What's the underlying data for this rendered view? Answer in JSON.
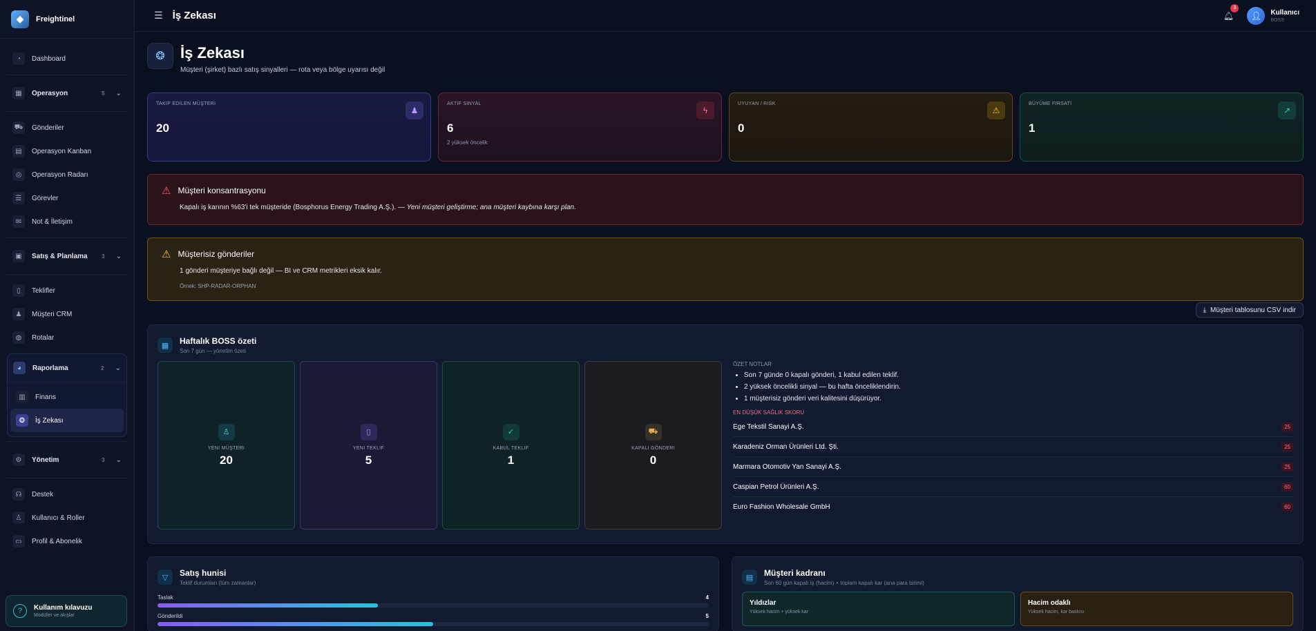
{
  "sidebar": {
    "brand": "Freightinel",
    "items": {
      "dashboard": "Dashboard",
      "operasyon": {
        "label": "Operasyon",
        "count": "5"
      },
      "gonderiler": "Gönderiler",
      "kanban": "Operasyon Kanban",
      "radar": "Operasyon Radarı",
      "gorevler": "Görevler",
      "not": "Not & İletişim",
      "satis": {
        "label": "Satış & Planlama",
        "count": "3"
      },
      "teklifler": "Teklifler",
      "crm": "Müşteri CRM",
      "rotalar": "Rotalar",
      "raporlama": {
        "label": "Raporlama",
        "count": "2"
      },
      "finans": "Finans",
      "iszekasi": "İş Zekası",
      "yonetim": {
        "label": "Yönetim",
        "count": "3"
      },
      "destek": "Destek",
      "kullanici": "Kullanıcı & Roller",
      "profil": "Profil & Abonelik"
    },
    "guide": {
      "title": "Kullanım kılavuzu",
      "sub": "Modüller ve akışlar"
    }
  },
  "topbar": {
    "title": "İş Zekası",
    "notif_count": "3",
    "user_name": "Kullanıcı",
    "user_role": "BOSS"
  },
  "page": {
    "title": "İş Zekası",
    "subtitle": "Müşteri (şirket) bazlı satış sinyalleri — rota veya bölge uyarısı değil"
  },
  "kpis": [
    {
      "label": "TAKIP EDILEN MÜŞTERI",
      "value": "20",
      "sub": ""
    },
    {
      "label": "AKTIF SINYAL",
      "value": "6",
      "sub": "2 yüksek öncelik"
    },
    {
      "label": "UYUYAN / RISK",
      "value": "0",
      "sub": ""
    },
    {
      "label": "BÜYÜME FIRSATI",
      "value": "1",
      "sub": ""
    }
  ],
  "alerts": {
    "concentration": {
      "title": "Müşteri konsantrasyonu",
      "body": "Kapalı iş karının %63'i tek müşteride (Bosphorus Energy Trading A.Ş.). — ",
      "emph": "Yeni müşteri geliştirme; ana müşteri kaybına karşı plan."
    },
    "orphan": {
      "title": "Müşterisiz gönderiler",
      "body": "1 gönderi müşteriye bağlı değil — BI ve CRM metrikleri eksik kalır.",
      "example": "Örnek: SHP-RADAR-ORPHAN"
    }
  },
  "csv_button": "Müşteri tablosunu CSV indir",
  "boss": {
    "title": "Haftalık BOSS özeti",
    "subtitle": "Son 7 gün — yönetim özeti",
    "cards": [
      {
        "label": "YENI MÜŞTERI",
        "value": "20"
      },
      {
        "label": "YENI TEKLIF",
        "value": "5"
      },
      {
        "label": "KABUL TEKLIF",
        "value": "1"
      },
      {
        "label": "KAPALI GÖNDERI",
        "value": "0"
      }
    ],
    "notes_heading": "ÖZET NOTLAR",
    "notes": [
      "Son 7 günde 0 kapalı gönderi, 1 kabul edilen teklif.",
      "2 yüksek öncelikli sinyal — bu hafta önceliklendirin.",
      "1 müşterisiz gönderi veri kalitesini düşürüyor."
    ],
    "low_heading": "EN DÜŞÜK SAĞLIK SKORU",
    "low": [
      {
        "name": "Ege Tekstil Sanayi A.Ş.",
        "score": "25"
      },
      {
        "name": "Karadeniz Orman Ürünleri Ltd. Şti.",
        "score": "25"
      },
      {
        "name": "Marmara Otomotiv Yan Sanayi A.Ş.",
        "score": "25"
      },
      {
        "name": "Caspian Petrol Ürünleri A.Ş.",
        "score": "60"
      },
      {
        "name": "Euro Fashion Wholesale GmbH",
        "score": "60"
      }
    ]
  },
  "funnel": {
    "title": "Satış hunisi",
    "subtitle": "Teklif durumları (tüm zamanlar)",
    "rows": [
      {
        "label": "Taslak",
        "value": "4",
        "fill": 0.4
      },
      {
        "label": "Gönderildi",
        "value": "5",
        "fill": 0.5
      }
    ]
  },
  "portfolio": {
    "title": "Müşteri kadranı",
    "subtitle": "Son 60 gün kapalı iş (hacim) × toplam kapalı kar (ana para birimi)",
    "segments": [
      {
        "title": "Yıldızlar",
        "sub": "Yüksek hacim + yüksek kar"
      },
      {
        "title": "Hacim odaklı",
        "sub": "Yüksek hacim, kar baskısı"
      }
    ]
  }
}
